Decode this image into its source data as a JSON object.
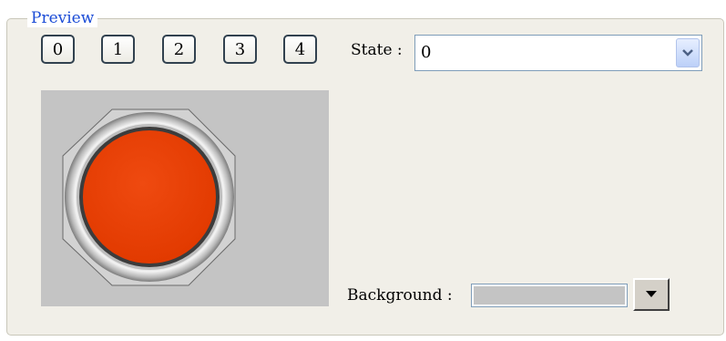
{
  "preview": {
    "group_label": "Preview",
    "state_buttons": [
      "0",
      "1",
      "2",
      "3",
      "4"
    ],
    "state_label": "State :",
    "state_value": "0",
    "background_label": "Background :",
    "background_color": "#c4c4c4"
  },
  "icons": {
    "state_dropdown": "chevron-down-icon",
    "background_dropdown": "triangle-down-icon"
  },
  "colors": {
    "legend_text": "#1a4bd6",
    "lamp_red": "#ea3d07",
    "panel_bg": "#f1efe8"
  }
}
